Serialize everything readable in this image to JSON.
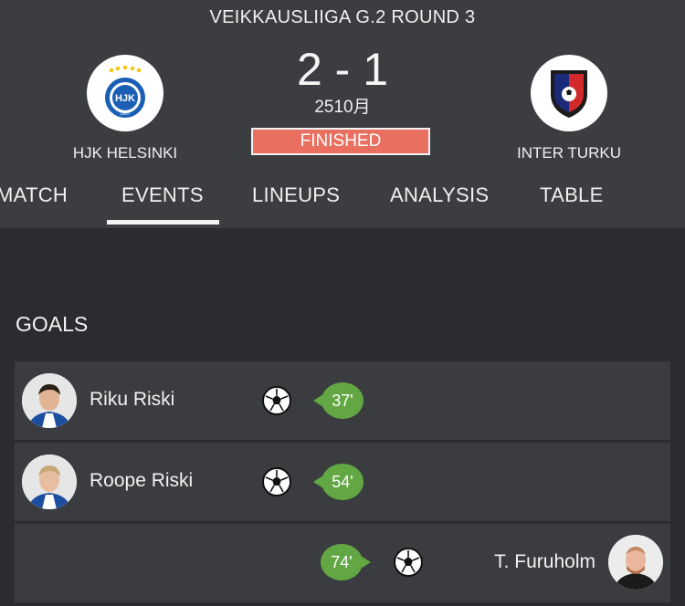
{
  "match": {
    "league": "VEIKKAUSLIIGA G.2 ROUND 3",
    "score": "2 - 1",
    "date": "2510月",
    "status": "FINISHED",
    "home_team": "HJK HELSINKI",
    "away_team": "INTER TURKU"
  },
  "tabs": [
    {
      "label": "MATCH"
    },
    {
      "label": "EVENTS",
      "active": true
    },
    {
      "label": "LINEUPS"
    },
    {
      "label": "ANALYSIS"
    },
    {
      "label": "TABLE"
    }
  ],
  "goals": {
    "title": "GOALS",
    "items": [
      {
        "player": "Riku Riski",
        "minute": "37'",
        "side": "home"
      },
      {
        "player": "Roope Riski",
        "minute": "54'",
        "side": "home"
      },
      {
        "player": "T. Furuholm",
        "minute": "74'",
        "side": "away"
      }
    ]
  },
  "colors": {
    "header_bg": "#3b3d40",
    "content_bg": "#2a2c2f",
    "row_bg": "#3a3c3f",
    "status_bg": "#e96f60",
    "minute_bg": "#62a744"
  },
  "icons": {
    "goal": "soccer-ball-icon",
    "home_logo": "hjk-crest-icon",
    "away_logo": "inter-turku-crest-icon"
  }
}
